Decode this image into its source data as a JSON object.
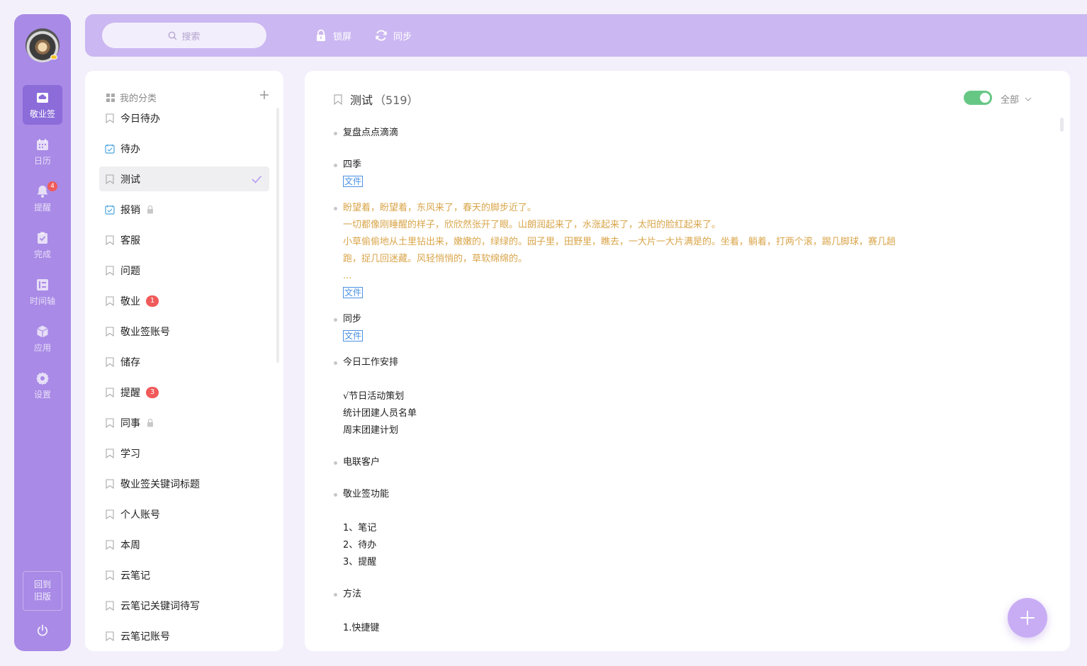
{
  "nav": {
    "items": [
      {
        "label": "敬业签",
        "icon": "cloud-note-icon",
        "active": true
      },
      {
        "label": "日历",
        "icon": "calendar-icon",
        "active": false
      },
      {
        "label": "提醒",
        "icon": "bell-icon",
        "active": false,
        "badge": "4"
      },
      {
        "label": "完成",
        "icon": "done-icon",
        "active": false
      },
      {
        "label": "时间轴",
        "icon": "timeline-icon",
        "active": false
      },
      {
        "label": "应用",
        "icon": "cube-icon",
        "active": false
      },
      {
        "label": "设置",
        "icon": "gear-icon",
        "active": false
      }
    ],
    "old_version": "回到旧版",
    "power_icon": "power-icon"
  },
  "topbar": {
    "search_placeholder": "搜索",
    "lock_label": "锁屏",
    "sync_label": "同步"
  },
  "categories": {
    "header": "我的分类",
    "items": [
      {
        "label": "今日待办",
        "icon": "bookmark-icon"
      },
      {
        "label": "待办",
        "icon": "todo-check-icon"
      },
      {
        "label": "测试",
        "icon": "bookmark-icon",
        "selected": true
      },
      {
        "label": "报销",
        "icon": "todo-check-icon",
        "locked": true
      },
      {
        "label": "客服",
        "icon": "bookmark-icon"
      },
      {
        "label": "问题",
        "icon": "bookmark-icon"
      },
      {
        "label": "敬业",
        "icon": "bookmark-icon",
        "badge": "1"
      },
      {
        "label": "敬业签账号",
        "icon": "bookmark-icon"
      },
      {
        "label": "储存",
        "icon": "bookmark-icon"
      },
      {
        "label": "提醒",
        "icon": "bookmark-icon",
        "badge": "3"
      },
      {
        "label": "同事",
        "icon": "bookmark-icon",
        "locked": true
      },
      {
        "label": "学习",
        "icon": "bookmark-icon"
      },
      {
        "label": "敬业签关键词标题",
        "icon": "bookmark-icon"
      },
      {
        "label": "个人账号",
        "icon": "bookmark-icon"
      },
      {
        "label": "本周",
        "icon": "bookmark-icon"
      },
      {
        "label": "云笔记",
        "icon": "bookmark-icon"
      },
      {
        "label": "云笔记关键词待写",
        "icon": "bookmark-icon"
      },
      {
        "label": "云笔记账号",
        "icon": "bookmark-icon"
      }
    ]
  },
  "main": {
    "title": "测试",
    "count": "（519）",
    "filter": "全部",
    "file_tag": "文件",
    "notes": [
      {
        "lines": [
          "复盘点点滴滴"
        ]
      },
      {
        "lines": [
          "四季"
        ],
        "file": true
      },
      {
        "lines": [
          "盼望着，盼望着，东风来了，春天的脚步近了。",
          "一切都像刚睡醒的样子，欣欣然张开了眼。山朗润起来了，水涨起来了，太阳的脸红起来了。",
          "小草偷偷地从土里钻出来，嫩嫩的，绿绿的。园子里，田野里，瞧去，一大片一大片满是的。坐着，躺着，打两个滚，踢几脚球，赛几趟",
          "跑，捉几回迷藏。风轻悄悄的，草软绵绵的。",
          "..."
        ],
        "file": true,
        "color": "#d9a54a"
      },
      {
        "lines": [
          "同步"
        ],
        "file": true
      },
      {
        "lines": [
          "今日工作安排",
          "",
          "√节日活动策划",
          "统计团建人员名单",
          "周末团建计划"
        ]
      },
      {
        "lines": [
          "电联客户"
        ]
      },
      {
        "lines": [
          "敬业签功能",
          "",
          "1、笔记",
          "2、待办",
          "3、提醒"
        ]
      },
      {
        "lines": [
          "方法",
          "",
          "1.快捷键"
        ]
      }
    ]
  }
}
